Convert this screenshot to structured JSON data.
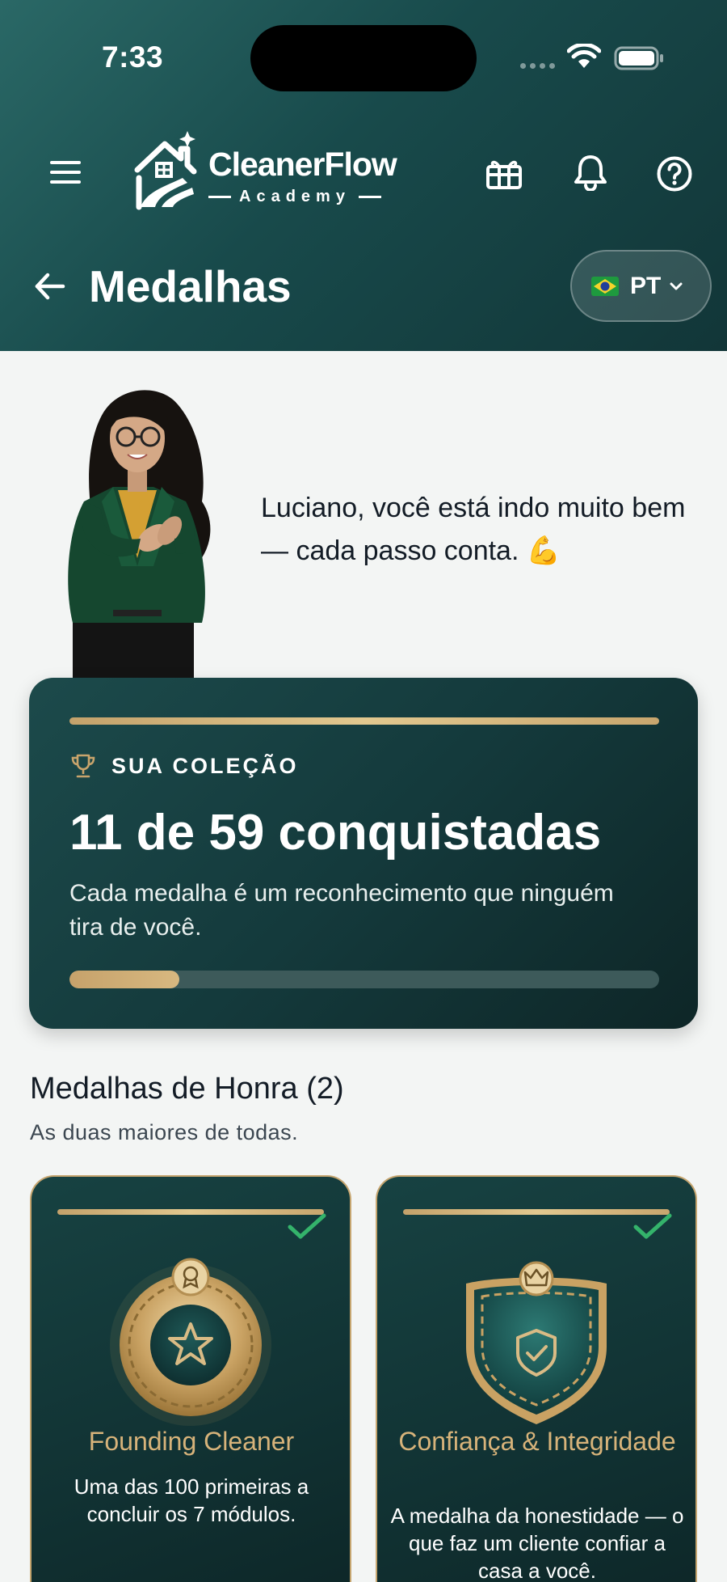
{
  "status_bar": {
    "time": "7:33"
  },
  "header": {
    "logo": {
      "title": "CleanerFlow",
      "subtitle": "Academy"
    },
    "page_title": "Medalhas",
    "language": {
      "code": "PT",
      "flag_icon": "brazil-flag-icon"
    },
    "icons": [
      "menu-icon",
      "gift-icon",
      "bell-icon",
      "help-icon",
      "back-arrow-icon"
    ],
    "colors": {
      "header_start": "#2a6866",
      "header_end": "#123638"
    }
  },
  "mascot": {
    "message": "Luciano, você está indo muito bem — cada passo conta. 💪"
  },
  "collection": {
    "label": "SUA COLEÇÃO",
    "count_text": "11 de 59 conquistadas",
    "earned": 11,
    "total": 59,
    "progress_fraction": 0.186,
    "description": "Cada medalha é um reconhecimento que ninguém tira de você.",
    "accent": "#c6a26b"
  },
  "honor_section": {
    "title": "Medalhas de Honra (2)",
    "subtitle": "As duas maiores de todas.",
    "medals": [
      {
        "name": "Founding Cleaner",
        "description": "Uma das 100 primeiras a concluir os 7 módulos.",
        "earned": true,
        "icon": "star-medal-icon"
      },
      {
        "name": "Confiança & Integridade",
        "description": "A medalha da honestidade — o que faz um cliente confiar a casa a você.",
        "earned": true,
        "icon": "shield-check-medal-icon"
      }
    ]
  }
}
